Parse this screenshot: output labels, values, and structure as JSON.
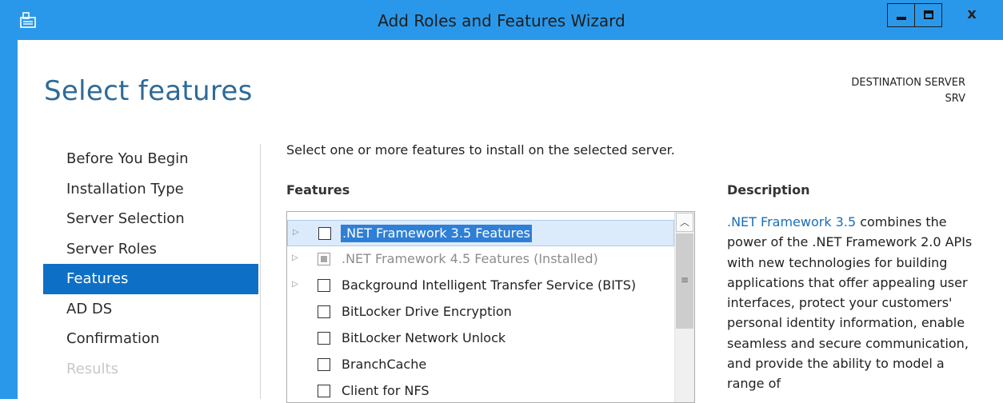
{
  "window": {
    "title": "Add Roles and Features Wizard",
    "close_glyph": "x"
  },
  "page": {
    "title": "Select features",
    "destination_label": "DESTINATION SERVER",
    "destination_server": "SRV"
  },
  "nav": {
    "items": [
      {
        "label": "Before You Begin",
        "state": "normal"
      },
      {
        "label": "Installation Type",
        "state": "normal"
      },
      {
        "label": "Server Selection",
        "state": "normal"
      },
      {
        "label": "Server Roles",
        "state": "normal"
      },
      {
        "label": "Features",
        "state": "active"
      },
      {
        "label": "AD DS",
        "state": "normal"
      },
      {
        "label": "Confirmation",
        "state": "normal"
      },
      {
        "label": "Results",
        "state": "disabled"
      }
    ]
  },
  "main": {
    "instruction": "Select one or more features to install on the selected server.",
    "features_header": "Features",
    "description_header": "Description",
    "features": [
      {
        "label": ".NET Framework 3.5 Features",
        "expandable": true,
        "checked": false,
        "disabled": false,
        "selected": true
      },
      {
        "label": ".NET Framework 4.5 Features (Installed)",
        "expandable": true,
        "checked": true,
        "disabled": true,
        "selected": false
      },
      {
        "label": "Background Intelligent Transfer Service (BITS)",
        "expandable": true,
        "checked": false,
        "disabled": false,
        "selected": false
      },
      {
        "label": "BitLocker Drive Encryption",
        "expandable": false,
        "checked": false,
        "disabled": false,
        "selected": false
      },
      {
        "label": "BitLocker Network Unlock",
        "expandable": false,
        "checked": false,
        "disabled": false,
        "selected": false
      },
      {
        "label": "BranchCache",
        "expandable": false,
        "checked": false,
        "disabled": false,
        "selected": false
      },
      {
        "label": "Client for NFS",
        "expandable": false,
        "checked": false,
        "disabled": false,
        "selected": false
      }
    ],
    "description": {
      "link_text": ".NET Framework 3.5",
      "text": " combines the power of the .NET Framework 2.0 APIs with new technologies for building applications that offer appealing user interfaces, protect your customers' personal identity information, enable seamless and secure communication, and provide the ability to model a range of"
    }
  },
  "icons": {
    "expand": "expand-arrow-icon",
    "scroll_up": "scroll-up-arrow-icon",
    "app": "server-manager-icon"
  },
  "colors": {
    "title_bar": "#2a98ea",
    "nav_active": "#0e6fc6",
    "page_title": "#2f6a97",
    "link": "#1a6fb9",
    "selection": "#2f7fd6"
  }
}
